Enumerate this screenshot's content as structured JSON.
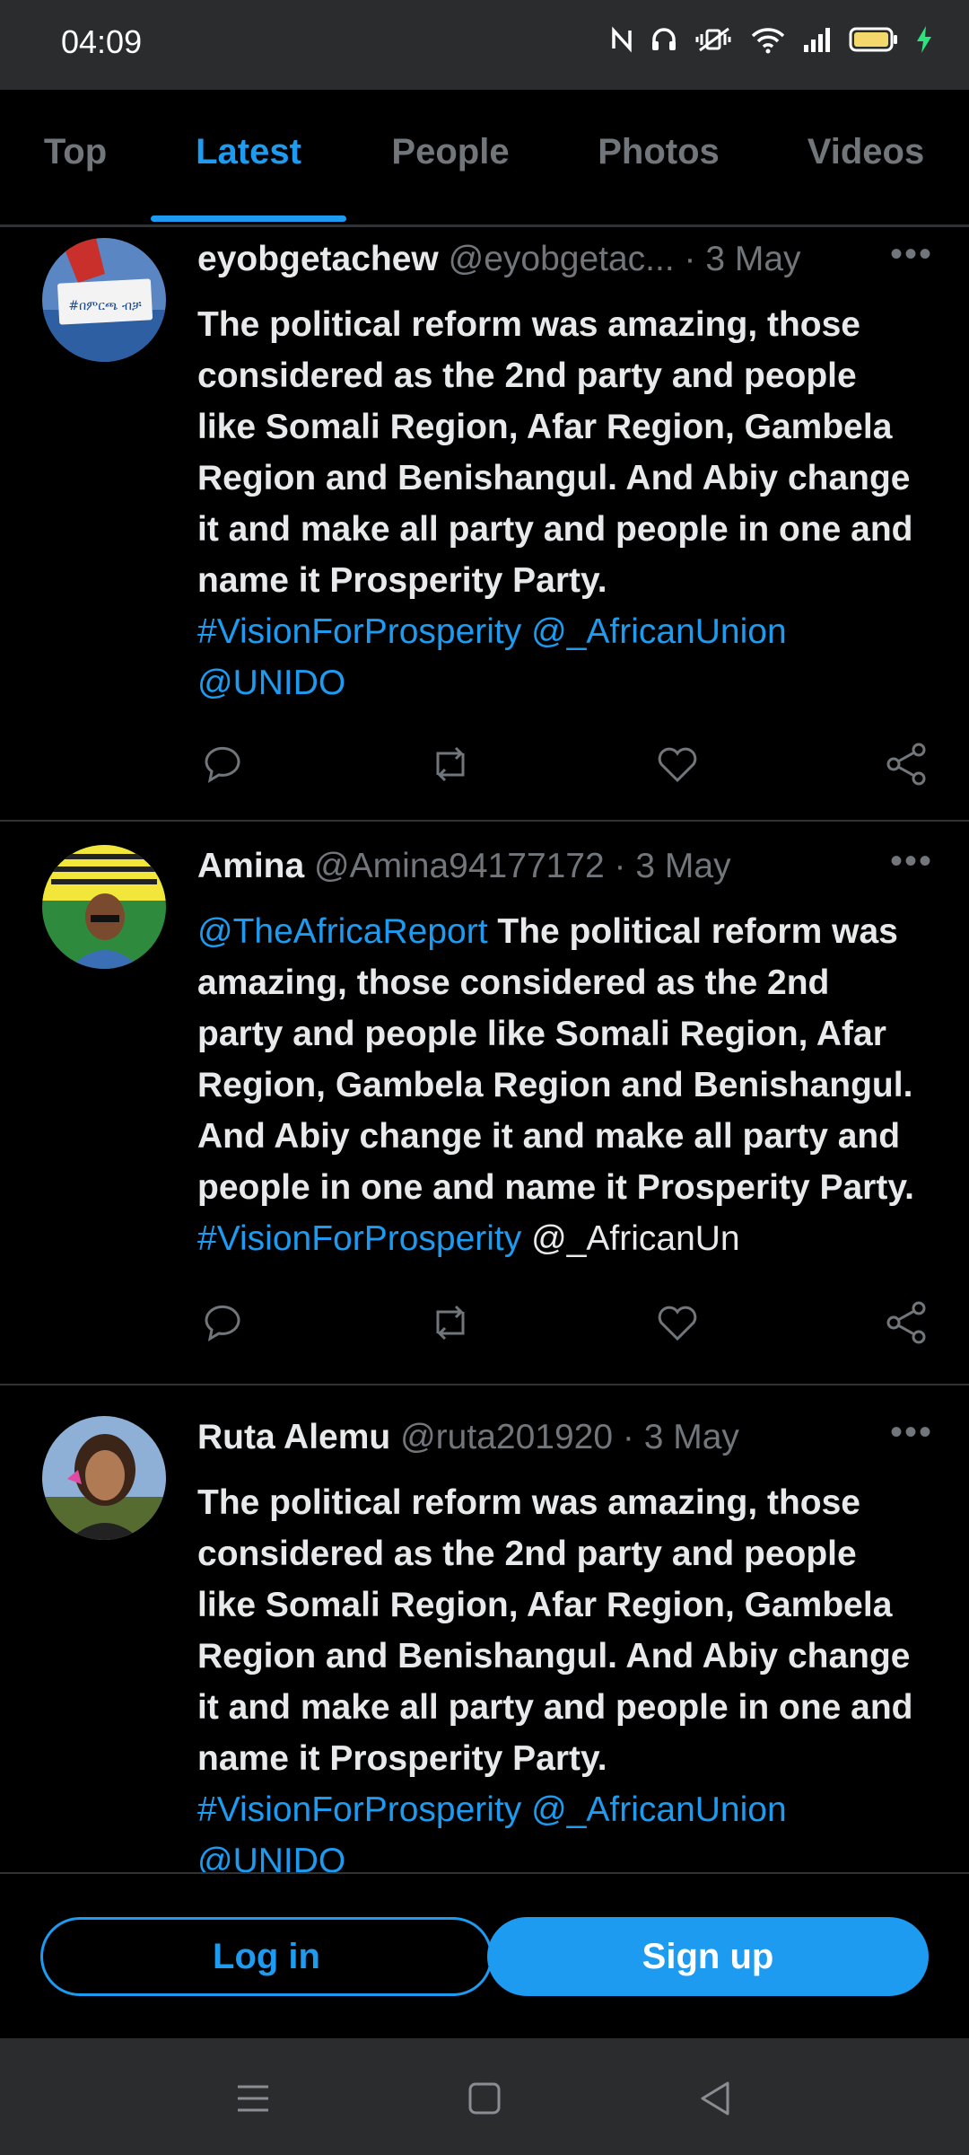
{
  "status_bar": {
    "time": "04:09",
    "icons": [
      "nfc-icon",
      "headset-icon",
      "vibrate-icon",
      "wifi-icon",
      "signal-icon",
      "battery-icon",
      "charging-icon"
    ]
  },
  "tabs": [
    {
      "label": "Top",
      "active": false
    },
    {
      "label": "Latest",
      "active": true
    },
    {
      "label": "People",
      "active": false
    },
    {
      "label": "Photos",
      "active": false
    },
    {
      "label": "Videos",
      "active": false
    }
  ],
  "tweets": [
    {
      "name": "eyobgetachew",
      "handle": "@eyobgetac...",
      "date": "· 3 May",
      "avatar_text": "#በምርጫ ብቻ",
      "body_lines": [
        "The political reform was amazing, those",
        "considered as the 2nd party and people",
        "like Somali Region, Afar Region, Gambela",
        "Region and Benishangul. And Abiy change",
        "it and make all party and people in one and",
        "name it Prosperity Party."
      ],
      "links_line1": "#VisionForProsperity @_AfricanUnion",
      "links_line2": "@UNIDO"
    },
    {
      "name": "Amina",
      "handle": "@Amina94177172",
      "date": "· 3 May",
      "lead_link": "@TheAfricaReport",
      "first_line_rest": " The political reform was",
      "body_lines": [
        "amazing, those considered as the 2nd",
        "party and people like Somali Region, Afar",
        "Region, Gambela Region and Benishangul.",
        "And Abiy change it and make all party and",
        "people in one and name it Prosperity Party."
      ],
      "hashtag": "#VisionForProsperity",
      "trailing": " @_AfricanUn"
    },
    {
      "name": "Ruta Alemu",
      "handle": "@ruta201920",
      "date": "· 3 May",
      "body_lines": [
        "The political reform was amazing, those",
        "considered as the 2nd party and people",
        "like Somali Region, Afar Region, Gambela",
        "Region and Benishangul. And Abiy change",
        "it and make all party and people in one and",
        "name it Prosperity Party."
      ],
      "links_line1": "#VisionForProsperity @_AfricanUnion",
      "links_line2": "@UNIDO"
    }
  ],
  "more_label": "•••",
  "auth": {
    "login_label": "Log in",
    "signup_label": "Sign up"
  },
  "colors": {
    "accent": "#1d9bf0",
    "background": "#000000",
    "muted": "#71767b",
    "divider": "#2f3336"
  }
}
